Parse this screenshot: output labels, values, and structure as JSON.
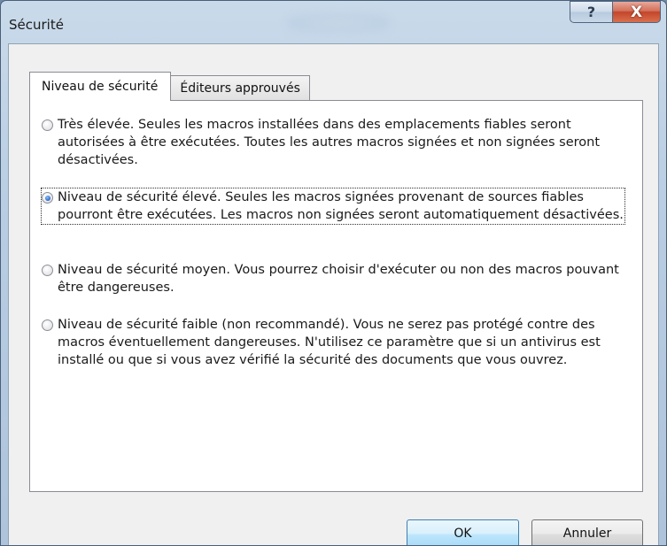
{
  "window": {
    "title": "Sécurité",
    "help_glyph": "?",
    "close_glyph": "X"
  },
  "tabs": [
    {
      "label": "Niveau de sécurité",
      "active": true
    },
    {
      "label": "Éditeurs approuvés",
      "active": false
    }
  ],
  "options": [
    {
      "text": "Très élevée. Seules les macros installées dans des emplacements fiables seront autorisées à être exécutées. Toutes les autres macros signées et non signées seront désactivées.",
      "selected": false
    },
    {
      "text": "Niveau de sécurité élevé. Seules les macros signées provenant de sources fiables pourront être exécutées. Les macros non signées seront automatiquement désactivées.",
      "selected": true
    },
    {
      "text": "Niveau de sécurité moyen. Vous pourrez choisir d'exécuter ou non des macros pouvant être dangereuses.",
      "selected": false
    },
    {
      "text": "Niveau de sécurité faible (non recommandé). Vous ne serez pas protégé contre des macros éventuellement dangereuses. N'utilisez ce paramètre que si un antivirus est installé ou que si vous avez vérifié la sécurité des documents que vous ouvrez.",
      "selected": false
    }
  ],
  "buttons": {
    "ok": "OK",
    "cancel": "Annuler"
  },
  "icons": {
    "help": "help-question-icon",
    "close": "close-x-icon"
  }
}
